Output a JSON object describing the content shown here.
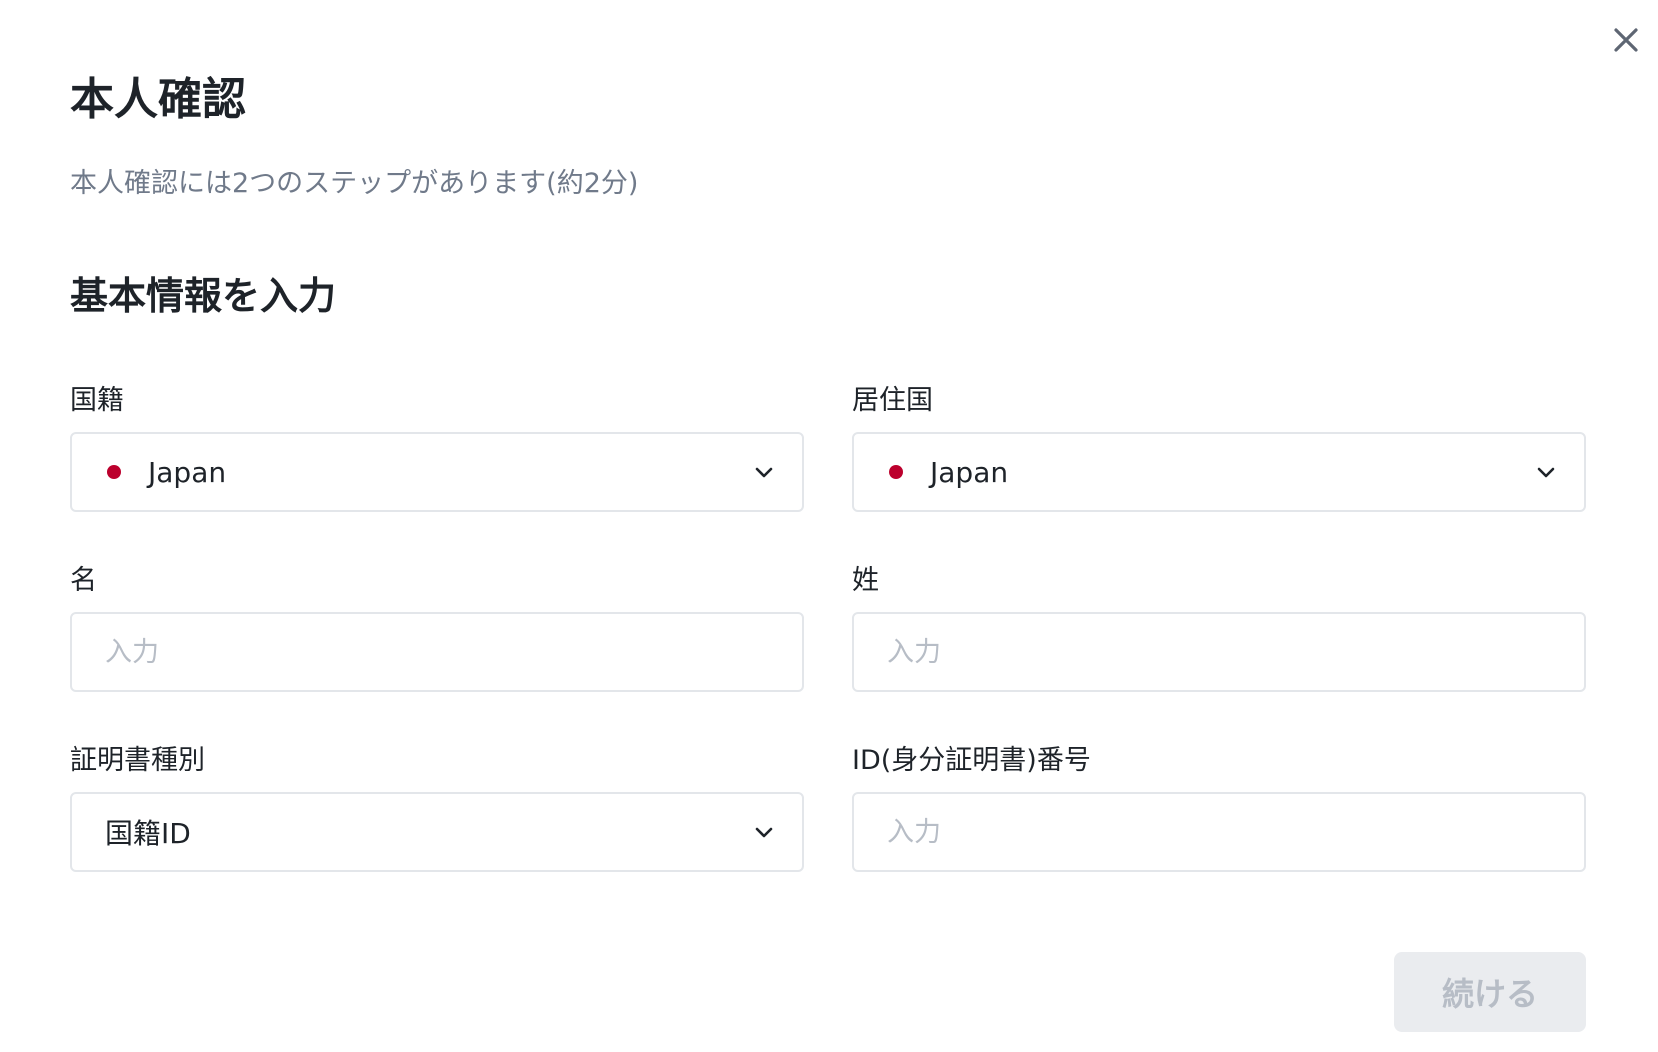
{
  "modal": {
    "close_icon": "close-icon",
    "title": "本人確認",
    "subtitle": "本人確認には2つのステップがあります(約2分)",
    "section_title": "基本情報を入力"
  },
  "form": {
    "nationality": {
      "label": "国籍",
      "value": "Japan",
      "flag_icon": "japan-flag-icon",
      "flag_color": "#bc002d",
      "dropdown_icon": "chevron-down-icon"
    },
    "residence": {
      "label": "居住国",
      "value": "Japan",
      "flag_icon": "japan-flag-icon",
      "flag_color": "#bc002d",
      "dropdown_icon": "chevron-down-icon"
    },
    "first_name": {
      "label": "名",
      "placeholder": "入力",
      "value": ""
    },
    "last_name": {
      "label": "姓",
      "placeholder": "入力",
      "value": ""
    },
    "document_type": {
      "label": "証明書種別",
      "value": "国籍ID",
      "dropdown_icon": "chevron-down-icon"
    },
    "id_number": {
      "label": "ID(身分証明書)番号",
      "placeholder": "入力",
      "value": ""
    }
  },
  "actions": {
    "continue_label": "続ける",
    "continue_enabled": false
  },
  "colors": {
    "text_primary": "#1e2329",
    "text_secondary": "#707a8a",
    "placeholder": "#b7bdc6",
    "border": "#e3e6ea",
    "button_disabled_bg": "#eaecef",
    "button_disabled_text": "#b7bdc6"
  }
}
